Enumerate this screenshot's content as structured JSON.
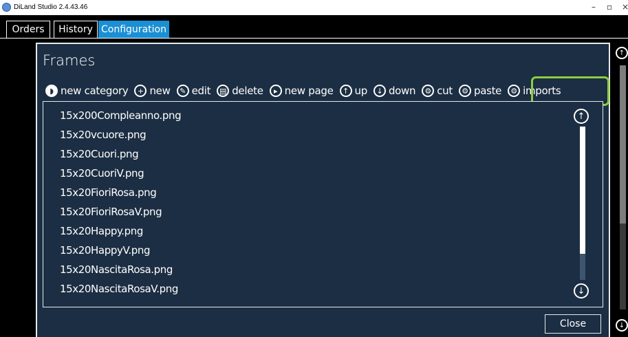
{
  "window": {
    "title": "DiLand Studio 2.4.43.46",
    "minimize": "–",
    "maximize": "▫",
    "close": "×"
  },
  "tabs": [
    {
      "label": "Orders",
      "active": false
    },
    {
      "label": "History",
      "active": false
    },
    {
      "label": "Configuration",
      "active": true
    }
  ],
  "dialog": {
    "title": "Frames",
    "toolbar": [
      {
        "label": "new category",
        "icon": "chat-bubble-icon"
      },
      {
        "label": "new",
        "icon": "plus-circle-icon"
      },
      {
        "label": "edit",
        "icon": "pencil-circle-icon"
      },
      {
        "label": "delete",
        "icon": "trash-circle-icon"
      },
      {
        "label": "new page",
        "icon": "play-circle-icon"
      },
      {
        "label": "up",
        "icon": "arrow-up-circle-icon"
      },
      {
        "label": "down",
        "icon": "arrow-down-circle-icon"
      },
      {
        "label": "cut",
        "icon": "gear-circle-icon"
      },
      {
        "label": "paste",
        "icon": "gear-circle-icon"
      },
      {
        "label": "imports",
        "icon": "gear-circle-icon"
      }
    ],
    "files": [
      "15x200Compleanno.png",
      "15x20vcuore.png",
      "15x20Cuori.png",
      "15x20CuoriV.png",
      "15x20FioriRosa.png",
      "15x20FioriRosaV.png",
      "15x20Happy.png",
      "15x20HappyV.png",
      "15x20NascitaRosa.png",
      "15x20NascitaRosaV.png"
    ],
    "close_label": "Close"
  },
  "colors": {
    "dialog_bg": "#1c2e43",
    "tab_active": "#1a8fd3",
    "highlight": "#8cce3f"
  }
}
